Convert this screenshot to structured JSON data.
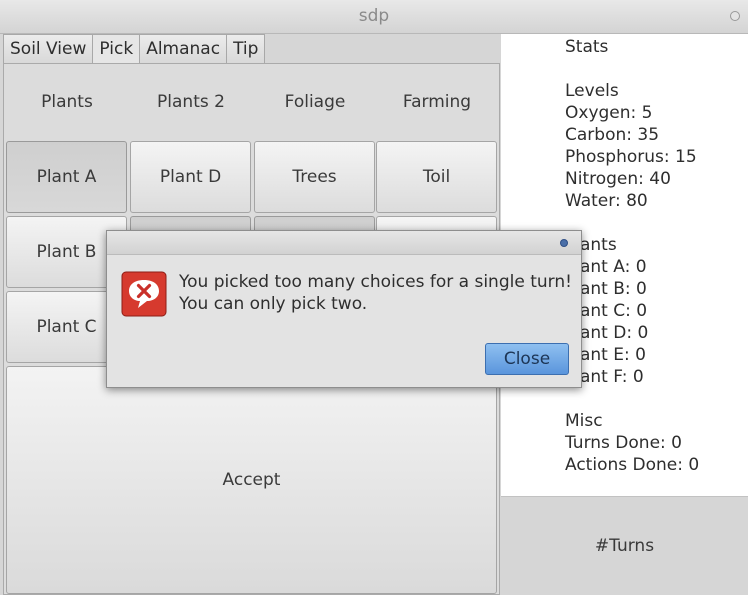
{
  "window": {
    "title": "sdp"
  },
  "tabs": [
    "Soil View",
    "Pick",
    "Almanac",
    "Tip"
  ],
  "categories": [
    "Plants",
    "Plants 2",
    "Foliage",
    "Farming"
  ],
  "grid": {
    "row1": [
      "Plant A",
      "Plant D",
      "Trees",
      "Toil"
    ],
    "row2": [
      "Plant B"
    ],
    "row3": [
      "Plant C"
    ]
  },
  "accept_label": "Accept",
  "stats": {
    "title": "Stats",
    "levels_header": "Levels",
    "levels": [
      "Oxygen: 5",
      "Carbon: 35",
      "Phosphorus: 15",
      "Nitrogen: 40",
      "Water: 80"
    ],
    "plants_header": "Plants",
    "plants": [
      "Plant A: 0",
      "Plant B: 0",
      "Plant C: 0",
      "Plant D: 0",
      "Plant E: 0",
      "Plant F: 0"
    ],
    "misc_header": "Misc",
    "misc": [
      "Turns Done: 0",
      "Actions Done: 0"
    ]
  },
  "turns_label": "#Turns",
  "dialog": {
    "icon": "error-icon",
    "line1": "You picked too many choices for a single turn!",
    "line2": "You can only pick two.",
    "close_label": "Close"
  },
  "colors": {
    "close_button": "#6aa4e4",
    "error_icon": "#d63a2e"
  }
}
